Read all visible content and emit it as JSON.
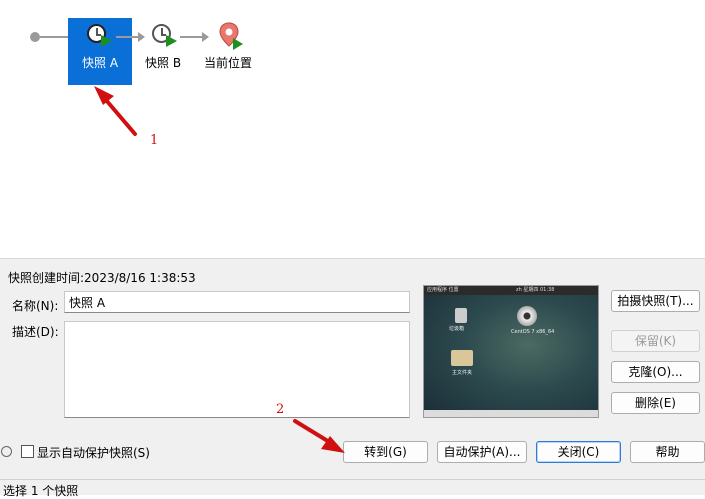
{
  "tree": {
    "nodes": [
      {
        "label": "快照 A",
        "selected": true,
        "icon": "snapshot-clock-icon"
      },
      {
        "label": "快照 B",
        "selected": false,
        "icon": "snapshot-clock-icon"
      },
      {
        "label": "当前位置",
        "selected": false,
        "icon": "current-location-pin-icon"
      }
    ],
    "annotations": [
      "1",
      "2"
    ],
    "selection_color": "#0a6fd6",
    "annotation_color": "#d01010"
  },
  "details": {
    "created_time": "快照创建时间:2023/8/16 1:38:53",
    "name_label": "名称(N):",
    "name_value": "快照 A",
    "desc_label": "描述(D):",
    "desc_value": ""
  },
  "thumbnail": {
    "desktop_icons": [
      "垃圾箱",
      "CentOS 7 x86_64",
      "主文件夹"
    ],
    "top_bar_left": "应用程序  位置",
    "top_bar_right": "zh  星期四 01:38"
  },
  "side_buttons": {
    "take_snapshot": "拍摄快照(T)...",
    "keep": "保留(K)",
    "clone": "克隆(O)...",
    "delete": "删除(E)"
  },
  "footer": {
    "show_autoprotect": "显示自动保护快照(S)",
    "goto": "转到(G)",
    "autoprotect": "自动保护(A)...",
    "close": "关闭(C)",
    "help": "帮助"
  },
  "status_bar": "选择 1 个快照"
}
